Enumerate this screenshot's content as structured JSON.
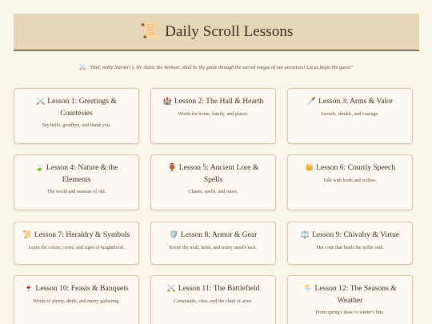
{
  "header": {
    "icon": "📜",
    "title": "Daily Scroll Lessons"
  },
  "intro": {
    "icon": "⚔️",
    "text": "\"Hail, noble learner! I, Sir Aldric the Verbose, shall be thy guide through the sacred tongue of our ancestors! Let us begin the quest!\""
  },
  "lessons": [
    {
      "icon": "⚔️",
      "title": "Lesson 1: Greetings & Courtesies",
      "desc": "Say hello, goodbye, and thank you."
    },
    {
      "icon": "🏰",
      "title": "Lesson 2: The Hall & Hearth",
      "desc": "Words for home, family, and places."
    },
    {
      "icon": "🗡️",
      "title": "Lesson 3: Arms & Valor",
      "desc": "Swords, shields, and courage."
    },
    {
      "icon": "🍃",
      "title": "Lesson 4: Nature & the Elements",
      "desc": "The world and seasons of old."
    },
    {
      "icon": "🏺",
      "title": "Lesson 5: Ancient Lore & Spells",
      "desc": "Chants, spells, and runes."
    },
    {
      "icon": "👑",
      "title": "Lesson 6: Courtly Speech",
      "desc": "Talk with lords and scribes."
    },
    {
      "icon": "📜",
      "title": "Lesson 7: Heraldry & Symbols",
      "desc": "Learn the colors, crests, and signs of knighthood."
    },
    {
      "icon": "🛡️",
      "title": "Lesson 8: Armor & Gear",
      "desc": "Know thy mail, helm, and trusty steed's tack."
    },
    {
      "icon": "⚖️",
      "title": "Lesson 9: Chivalry & Virtue",
      "desc": "The code that binds the noble soul."
    },
    {
      "icon": "🍷",
      "title": "Lesson 10: Feasts & Banquets",
      "desc": "Words of plenty, drink, and merry gathering."
    },
    {
      "icon": "⚔️",
      "title": "Lesson 11: The Battlefield",
      "desc": "Commands, cries, and the clash of arms."
    },
    {
      "icon": "🌦️",
      "title": "Lesson 12: The Seasons & Weather",
      "desc": "From spring's thaw to winter's bite."
    }
  ]
}
